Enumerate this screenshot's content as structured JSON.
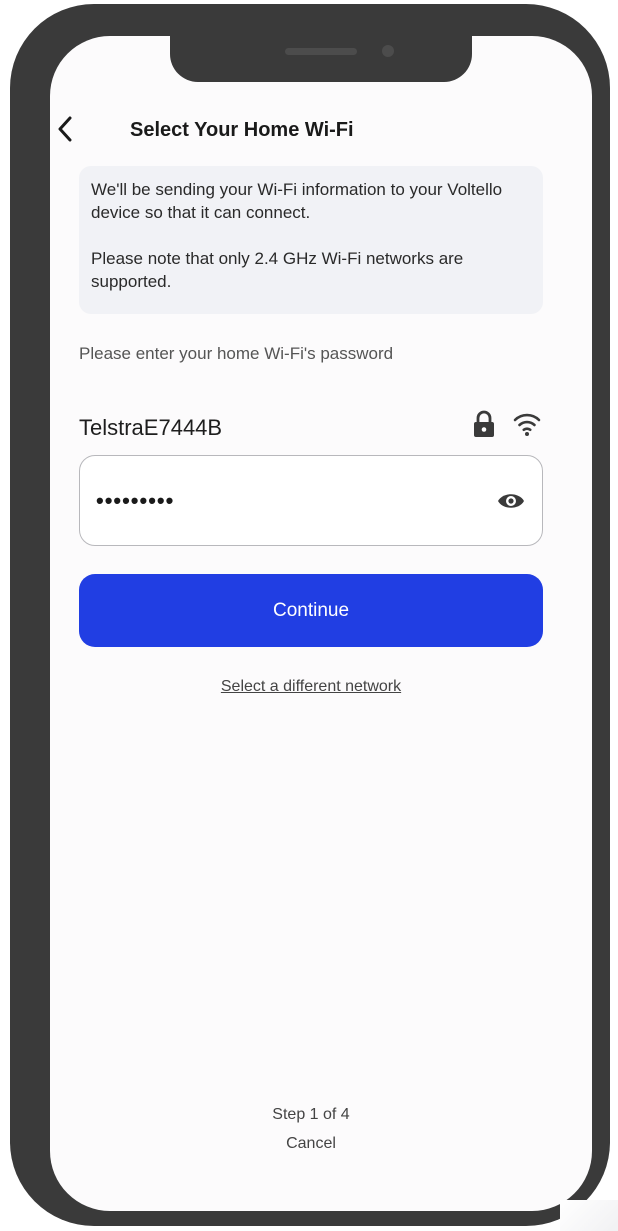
{
  "header": {
    "title": "Select Your Home Wi-Fi",
    "back_icon": "chevron-left-icon"
  },
  "info": {
    "paragraph1": "We'll be sending your Wi-Fi information to your Voltello device so that it can connect.",
    "paragraph2": "Please note that only 2.4 GHz Wi-Fi networks are supported."
  },
  "form": {
    "prompt": "Please enter your home Wi-Fi's password",
    "network_name": "TelstraE7444B",
    "network_icons": [
      "lock-icon",
      "wifi-icon"
    ],
    "password_masked": "•••••••••",
    "reveal_icon": "eye-icon"
  },
  "actions": {
    "continue_label": "Continue",
    "different_network_label": "Select a different network"
  },
  "footer": {
    "step_text": "Step 1 of 4",
    "cancel_label": "Cancel"
  },
  "colors": {
    "primary_button": "#213ee3",
    "phone_frame": "#3a3a3a",
    "info_background": "#f1f2f6"
  }
}
